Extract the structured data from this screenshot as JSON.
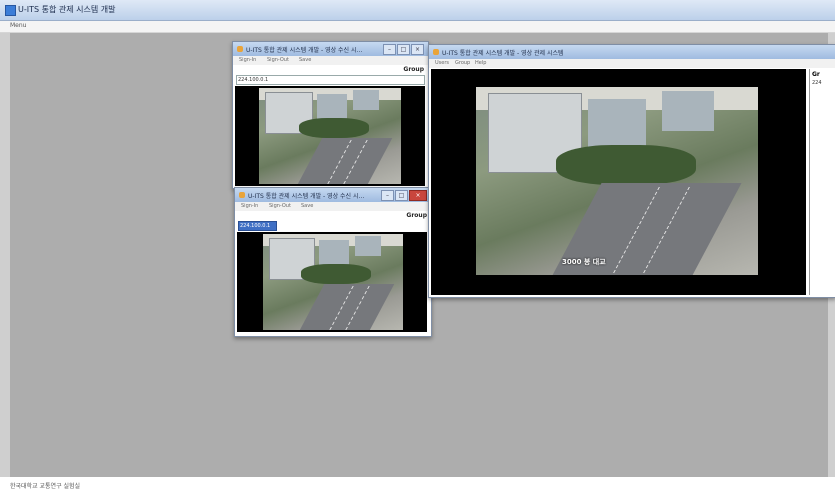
{
  "app": {
    "title": "U-ITS 통합 관제 시스템 개발",
    "menu": "Menu",
    "status_text": "한국대학교 교통연구 실험실"
  },
  "windows": [
    {
      "id": "viewer-top",
      "title": "U-ITS 통합 관제 시스템 개발 - 영상 수신 시...",
      "menu": [
        "Sign-In",
        "Sign-Out",
        "Save"
      ],
      "group_label": "Group",
      "ip_value": "224.100.0.1",
      "overlay": ""
    },
    {
      "id": "viewer-bottom",
      "title": "U-ITS 통합 관제 시스템 개발 - 영상 수신 시...",
      "menu": [
        "Sign-In",
        "Sign-Out",
        "Save"
      ],
      "group_label": "Group",
      "ip_value": "224.100.0.1",
      "overlay": ""
    },
    {
      "id": "viewer-main",
      "title": "U-ITS 통합 관제 시스템 개발 - 영상 관제 시스템",
      "menu": [
        "Users",
        "Group",
        "Help"
      ],
      "side_panel_label": "Gr",
      "side_panel_value": "224",
      "overlay": "3000 봉 대교"
    }
  ],
  "colors": {
    "mdi_background": "#adadad",
    "titlebar": "#bcd0ea",
    "close_button": "#c9463d"
  }
}
